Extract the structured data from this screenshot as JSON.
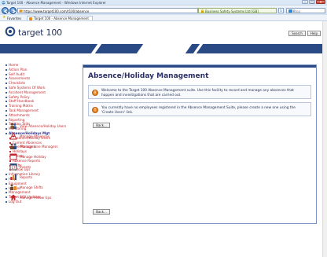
{
  "window": {
    "title": "Target 100 - Absence Management - Windows Internet Explorer",
    "controls": [
      "–",
      "□",
      "✕"
    ]
  },
  "address_bar": {
    "url": "https://www.target100.com/t100/absence",
    "cert_label": "Business Safety Systems Ltd [GB]",
    "search_placeholder": "Bing"
  },
  "favorites": {
    "label": "Favorites",
    "tab_label": "Target 100 - Absence Management"
  },
  "header": {
    "logo_text": "target 100",
    "search_button": "Search",
    "help_button": "Help"
  },
  "sidebar": {
    "items": [
      {
        "label": "Home",
        "level": 0
      },
      {
        "label": "Action Plan",
        "level": 0
      },
      {
        "label": "Self Audit",
        "level": 0
      },
      {
        "label": "Assessments",
        "level": 0
      },
      {
        "label": "Checklists",
        "level": 0
      },
      {
        "label": "Safe Systems Of Work",
        "level": 0
      },
      {
        "label": "Accident Management",
        "level": 0
      },
      {
        "label": "Safety Policy",
        "level": 0
      },
      {
        "label": "Staff Handbook",
        "level": 0
      },
      {
        "label": "Training Matrix",
        "level": 0
      },
      {
        "label": "Task Management",
        "level": 0
      },
      {
        "label": "Attachments",
        "level": 0
      },
      {
        "label": "Reporting",
        "level": 0
      },
      {
        "label": "Toolbox Talks",
        "level": 0
      },
      {
        "label": "Monitoring",
        "level": 0
      },
      {
        "label": "Absence/Holidays Mgt",
        "level": 0,
        "active": true
      },
      {
        "label": "Absence/Holiday Users",
        "level": 1
      },
      {
        "label": "Current Absences",
        "level": 1
      },
      {
        "label": "Line Managers",
        "level": 1
      },
      {
        "label": "Holidays",
        "level": 1
      },
      {
        "label": "Events",
        "level": 1
      },
      {
        "label": "Absence Reports",
        "level": 1
      },
      {
        "label": "Shifts",
        "level": 1
      },
      {
        "label": "Follow Ups",
        "level": 1
      },
      {
        "label": "Information Library",
        "level": 0
      },
      {
        "label": "Help",
        "level": 0
      },
      {
        "label": "Equipment",
        "level": 0
      },
      {
        "label": "Injuries",
        "level": 0
      },
      {
        "label": "Management",
        "level": 0
      },
      {
        "label": "Target 100 Updates",
        "level": 0
      },
      {
        "label": "Log Out",
        "level": 0
      }
    ]
  },
  "main": {
    "title": "Absence/Holiday Management",
    "welcome_text": "Welcome to the Target 100 Absence Management suite. Use this facility to record and manage any absences that happen and investigations that are carried out.",
    "notice_text": "You currently have no employees registered in the Absence Management Suite, please create a new one using the 'Create Users' link.",
    "back_label": "Back...",
    "menu": [
      {
        "label": "View Absence/Holiday Users",
        "icon": "users-icon"
      },
      {
        "label": "Manage Absences",
        "icon": "medical-icon"
      },
      {
        "label": "Manage Line Managers",
        "icon": "managers-icon"
      },
      {
        "label": "Manage Holiday",
        "icon": "calendar-icon"
      },
      {
        "label": "Events",
        "icon": "events-icon"
      },
      {
        "label": "Reports",
        "icon": "reports-icon"
      },
      {
        "label": "Manage Shifts",
        "icon": "shifts-icon"
      },
      {
        "label": "Manage Follow Ups",
        "icon": "followup-icon"
      }
    ]
  },
  "colors": {
    "brand_navy": "#2a4a86",
    "link_red": "#c2272d",
    "heading": "#2b2f66"
  }
}
